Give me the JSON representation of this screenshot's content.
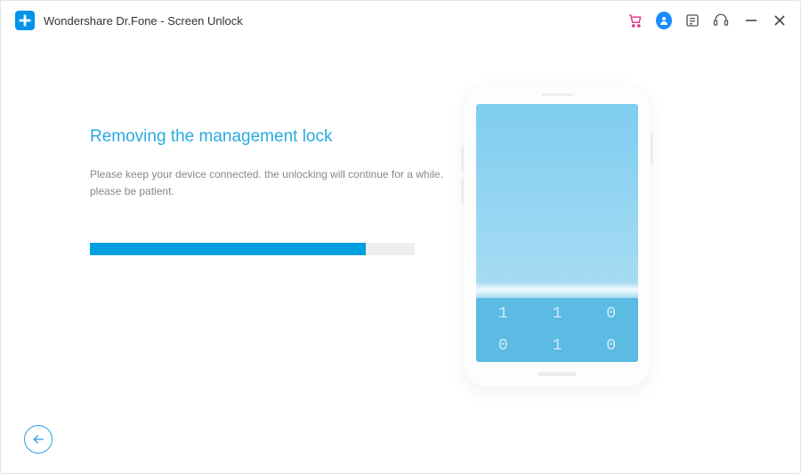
{
  "titlebar": {
    "app_title": "Wondershare Dr.Fone - Screen Unlock"
  },
  "main": {
    "heading": "Removing the management lock",
    "subtext_line1": "Please keep your device connected. the unlocking will continue for a while.",
    "subtext_line2": "please be patient.",
    "progress_percent": 85
  },
  "phone": {
    "keypad": [
      "1",
      "1",
      "0",
      "0",
      "1",
      "0"
    ]
  },
  "colors": {
    "accent": "#00a0e0",
    "heading": "#29a9e1"
  }
}
